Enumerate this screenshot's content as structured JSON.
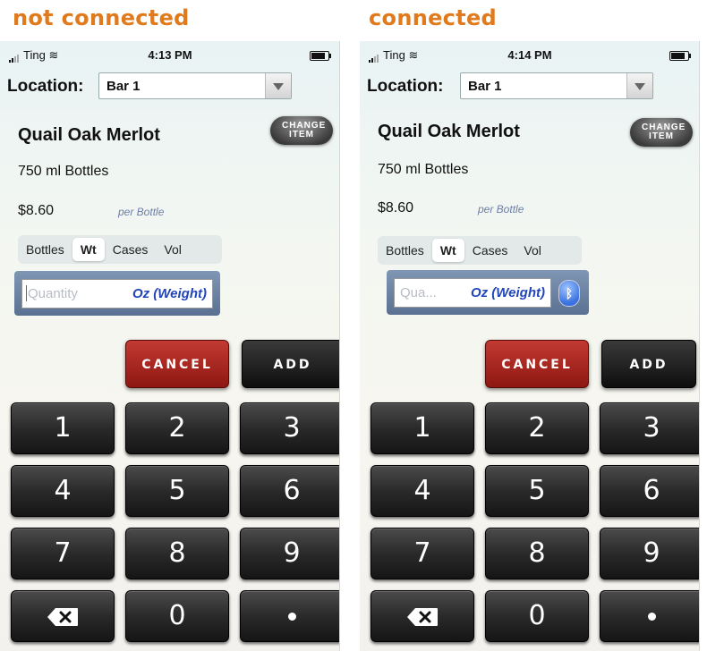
{
  "panels": [
    {
      "heading": "not connected",
      "status": {
        "carrier": "Ting",
        "time": "4:13 PM"
      },
      "location_label": "Location:",
      "location_value": "Bar 1",
      "item_name": "Quail Oak Merlot",
      "change_item_label": "CHANGE ITEM",
      "size": "750 ml Bottles",
      "price": "$8.60",
      "per_unit": "per Bottle",
      "segments": [
        "Bottles",
        "Wt",
        "Cases",
        "Vol"
      ],
      "active_segment": "Wt",
      "quantity_placeholder": "Quantity",
      "quantity_unit": "Oz (Weight)",
      "bluetooth_icon": "",
      "cancel_label": "CANCEL",
      "add_label": "ADD",
      "keys": [
        "1",
        "2",
        "3",
        "4",
        "5",
        "6",
        "7",
        "8",
        "9",
        "backspace",
        "0",
        "."
      ]
    },
    {
      "heading": "connected",
      "status": {
        "carrier": "Ting",
        "time": "4:14 PM"
      },
      "location_label": "Location:",
      "location_value": "Bar 1",
      "item_name": "Quail Oak Merlot",
      "change_item_label": "CHANGE ITEM",
      "size": "750 ml Bottles",
      "price": "$8.60",
      "per_unit": "per Bottle",
      "segments": [
        "Bottles",
        "Wt",
        "Cases",
        "Vol"
      ],
      "active_segment": "Wt",
      "quantity_placeholder": "Qua...",
      "quantity_unit": "Oz (Weight)",
      "bluetooth_icon": "bluetooth-icon",
      "cancel_label": "CANCEL",
      "add_label": "ADD",
      "keys": [
        "1",
        "2",
        "3",
        "4",
        "5",
        "6",
        "7",
        "8",
        "9",
        "backspace",
        "0",
        "."
      ]
    }
  ],
  "colors": {
    "heading": "#e07a1c",
    "cancel": "#b02a22",
    "unit_text": "#2245b8"
  }
}
